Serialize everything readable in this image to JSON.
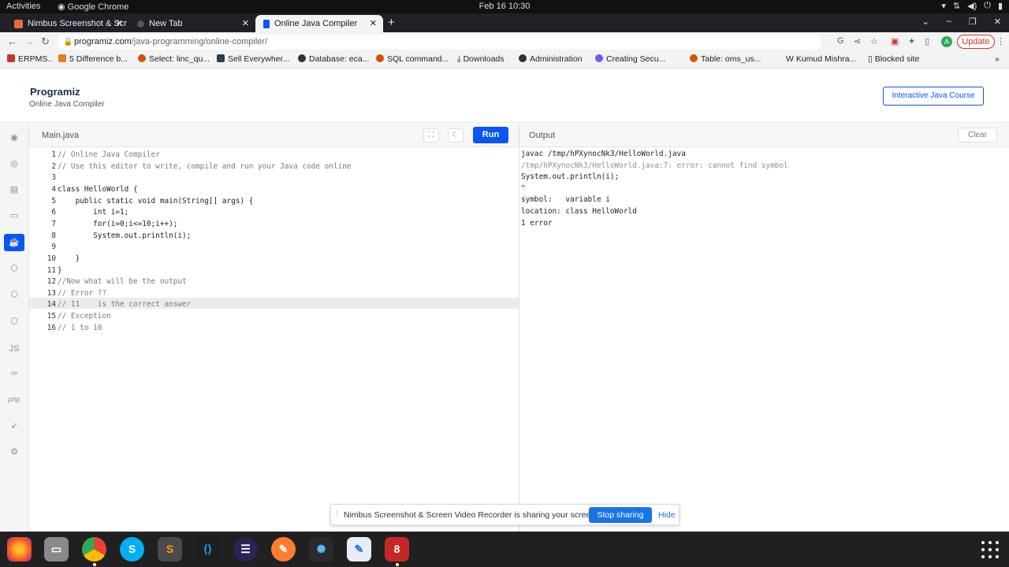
{
  "topbar": {
    "activities": "Activities",
    "app": "Google Chrome",
    "clock": "Feb 16  10:30"
  },
  "tabs": [
    {
      "label": "Nimbus Screenshot & Scr"
    },
    {
      "label": "New Tab"
    },
    {
      "label": "Online Java Compiler"
    }
  ],
  "address": {
    "domain": "programiz.com",
    "path": "/java-programming/online-compiler/"
  },
  "profile": {
    "initial": "A"
  },
  "update_label": "Update",
  "bookmarks": [
    {
      "label": "ERPMS.."
    },
    {
      "label": "5 Difference b..."
    },
    {
      "label": "Select: linc_qu..."
    },
    {
      "label": "Sell Everywher..."
    },
    {
      "label": "Database: eca..."
    },
    {
      "label": "SQL command..."
    },
    {
      "label": "Downloads"
    },
    {
      "label": "Administration"
    },
    {
      "label": "Creating Secu..."
    },
    {
      "label": "Table: oms_us..."
    },
    {
      "label": "Kumud Mishra..."
    },
    {
      "label": "Blocked site"
    }
  ],
  "site": {
    "logo": "Programiz",
    "subtitle": "Online Java Compiler",
    "course_button": "Interactive Java Course"
  },
  "sidebar": {
    "langs": [
      "",
      "",
      "",
      "",
      "",
      "",
      "",
      "",
      "JS",
      "",
      "php",
      "",
      ""
    ]
  },
  "editor": {
    "file": "Main.java",
    "run_label": "Run",
    "lines": [
      {
        "n": "1",
        "text": "// Online Java Compiler"
      },
      {
        "n": "2",
        "text": "// Use this editor to write, compile and run your Java code online"
      },
      {
        "n": "3",
        "text": ""
      },
      {
        "n": "4",
        "text": "class HelloWorld {"
      },
      {
        "n": "5",
        "text": "    public static void main(String[] args) {"
      },
      {
        "n": "6",
        "text": "        int i=1;"
      },
      {
        "n": "7",
        "text": "        for(i=0;i<=10;i++);"
      },
      {
        "n": "8",
        "text": "        System.out.println(i);"
      },
      {
        "n": "9",
        "text": ""
      },
      {
        "n": "10",
        "text": "    }"
      },
      {
        "n": "11",
        "text": "}"
      },
      {
        "n": "12",
        "text": "//Now what will be the output"
      },
      {
        "n": "13",
        "text": "// Error ??"
      },
      {
        "n": "14",
        "text": "// 11    is the correct answer"
      },
      {
        "n": "15",
        "text": "// Exception"
      },
      {
        "n": "16",
        "text": "// 1 to 10"
      }
    ]
  },
  "output": {
    "title": "Output",
    "clear_label": "Clear",
    "lines": [
      "javac /tmp/hPXynocNk3/HelloWorld.java",
      "/tmp/hPXynocNk3/HelloWorld.java:7: error: cannot find symbol",
      "System.out.println(i);",
      "^",
      "symbol:   variable i",
      "location: class HelloWorld",
      "1 error"
    ]
  },
  "share": {
    "text": "Nimbus Screenshot & Screen Video Recorder is sharing your screen.",
    "stop": "Stop sharing",
    "hide": "Hide"
  },
  "colors": {
    "accent": "#0556f3",
    "share_blue": "#1a73e8",
    "update_red": "#d93025"
  }
}
